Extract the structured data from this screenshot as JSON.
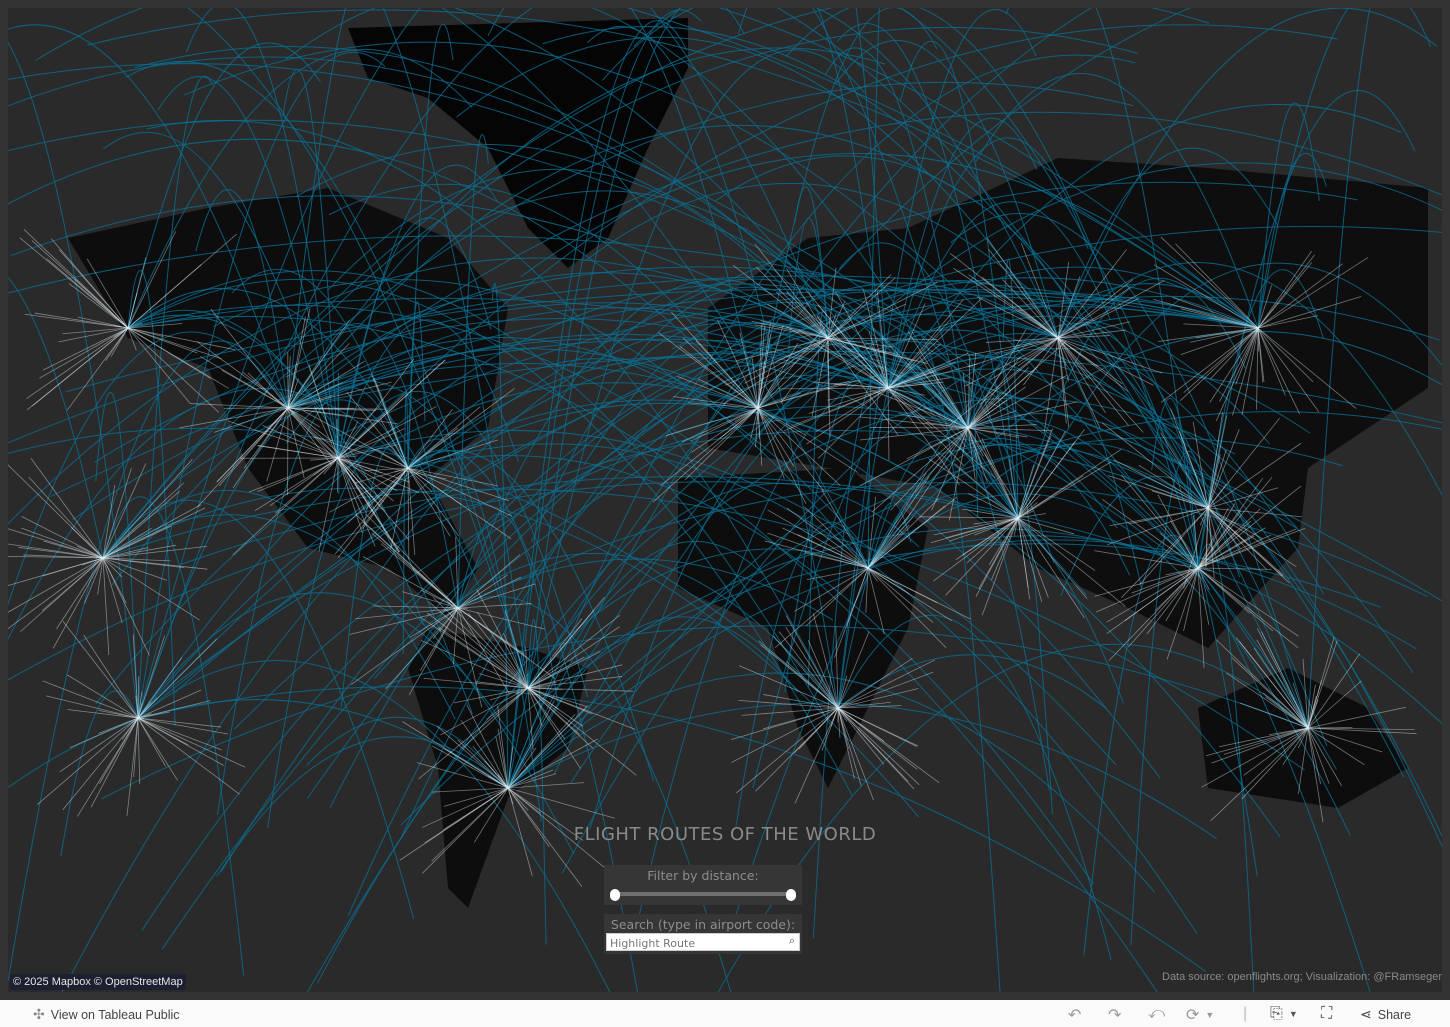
{
  "map": {
    "title": "FLIGHT ROUTES OF THE WORLD",
    "colors": {
      "background": "#2a2a2a",
      "land": "#0a0a0a",
      "long_routes": "#0a6f94",
      "dense_routes": "#e6f2f8"
    },
    "filter": {
      "label": "Filter by distance:",
      "range_fraction": [
        0,
        1
      ]
    },
    "search": {
      "label": "Search (type in airport code):",
      "placeholder": "Highlight Route",
      "icon": "search-icon"
    },
    "attribution": "© 2025 Mapbox  © OpenStreetMap",
    "credit": "Data source: openflights.org; Visualization: @FRamseger"
  },
  "toolbar": {
    "view_on": "View on Tableau Public",
    "share": "Share",
    "icons": [
      "undo-icon",
      "redo-icon",
      "revert-icon",
      "refresh-icon",
      "download-icon",
      "fullscreen-icon",
      "share-icon"
    ]
  }
}
